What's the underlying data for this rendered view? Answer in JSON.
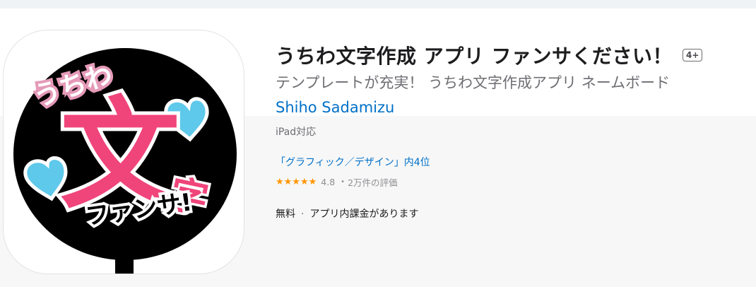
{
  "app": {
    "title": "うちわ文字作成 アプリ ファンサください！",
    "age_rating": "4+",
    "subtitle": "テンプレートが充実！ うちわ文字作成アプリ ネームボード",
    "developer": "Shiho Sadamizu",
    "device_support": "iPad対応",
    "ranking": "「グラフィック／デザイン」内4位",
    "rating": {
      "stars": "★★★★★",
      "value": "4.8",
      "separator": "•",
      "count": "2万件の評価"
    },
    "price": "無料",
    "price_separator": "·",
    "in_app": "アプリ内課金があります"
  },
  "icon": {
    "name": "uchiwa-icon",
    "word_top": "うちわ",
    "word_main": "文",
    "word_side": "字",
    "word_bottom": "ファンサ!",
    "colors": {
      "fan": "#000000",
      "pink": "#f0457a",
      "outline": "#e59ab8",
      "heart": "#5ec9ea"
    }
  },
  "colors": {
    "link": "#0070c9",
    "star": "#ff9500"
  }
}
